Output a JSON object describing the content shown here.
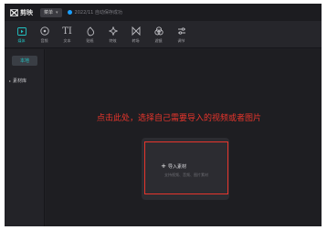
{
  "titlebar": {
    "app_name": "剪映",
    "menu_label": "菜单",
    "status_text": "2022/11 自动保存成功"
  },
  "toolbar": {
    "items": [
      {
        "label": "媒体",
        "icon": "media-icon",
        "active": true
      },
      {
        "label": "音频",
        "icon": "audio-icon",
        "active": false
      },
      {
        "label": "文本",
        "icon": "text-icon",
        "active": false
      },
      {
        "label": "贴纸",
        "icon": "sticker-icon",
        "active": false
      },
      {
        "label": "特效",
        "icon": "effects-icon",
        "active": false
      },
      {
        "label": "转场",
        "icon": "transition-icon",
        "active": false
      },
      {
        "label": "滤镜",
        "icon": "filter-icon",
        "active": false
      },
      {
        "label": "调节",
        "icon": "adjust-icon",
        "active": false
      }
    ]
  },
  "sidebar": {
    "tab_label": "本地",
    "item_label": "素材库"
  },
  "main": {
    "instruction": "点击此处，选择自己需要导入的视频或者图片",
    "import_label": "导入素材",
    "hint": "支持视频、音频、图片素材"
  },
  "colors": {
    "accent": "#22c3c3",
    "annotation_red": "#e8352c",
    "background": "#1e1e22"
  }
}
